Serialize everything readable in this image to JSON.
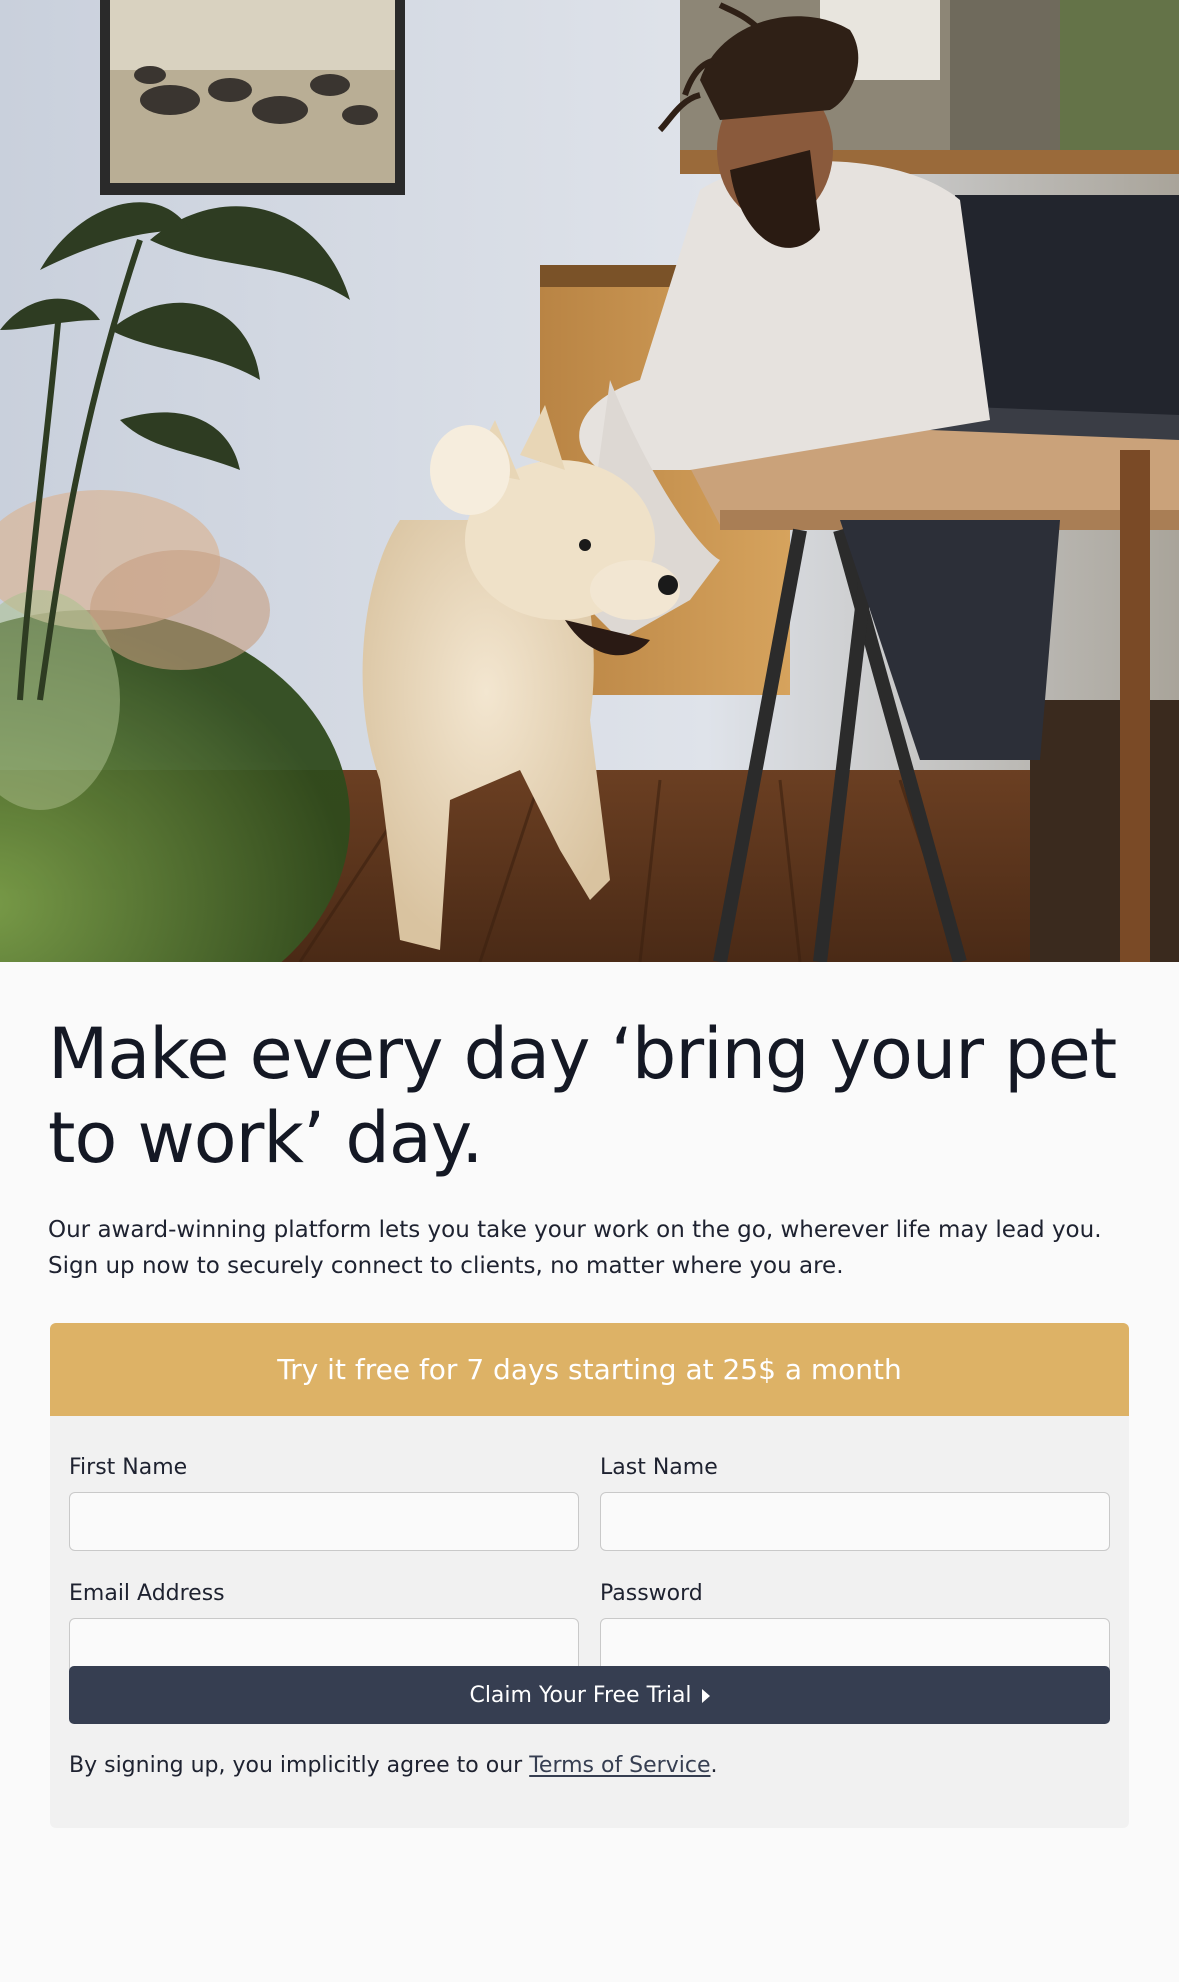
{
  "hero": {
    "image_description_icon": "hero-photo"
  },
  "main": {
    "headline": "Make every day ‘bring your pet to work’ day.",
    "intro": "Our award-winning platform lets you take your work on the go, wherever life may lead you. Sign up now to securely connect to clients, no matter where you are."
  },
  "signup": {
    "banner": "Try it free for 7 days starting at 25$ a month",
    "first_name_label": "First Name",
    "first_name_value": "",
    "last_name_label": "Last Name",
    "last_name_value": "",
    "email_label": "Email Address",
    "email_value": "",
    "password_label": "Password",
    "password_value": "",
    "submit_label": "Claim Your Free Trial",
    "submit_icon": "caret-right-icon",
    "legal_prefix": "By signing up, you implicitly agree to our ",
    "legal_link": "Terms of Service",
    "legal_suffix": "."
  },
  "colors": {
    "banner": "#ddb266",
    "button": "#363e51",
    "card": "#f1f1f1",
    "page": "#fafafa"
  }
}
